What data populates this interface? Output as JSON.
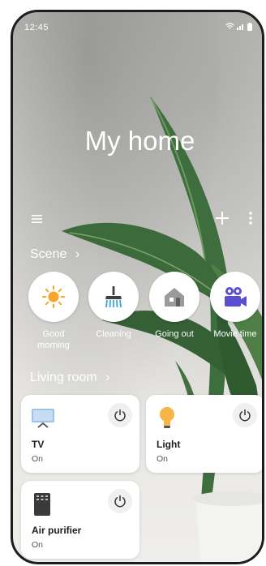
{
  "status_bar": {
    "time": "12:45",
    "icons": [
      "wifi-icon",
      "signal-icon",
      "battery-icon"
    ]
  },
  "header": {
    "title": "My home"
  },
  "toolbar": {
    "menu_icon": "menu-icon",
    "add_icon": "plus-icon",
    "more_icon": "more-vertical-icon"
  },
  "scene_section": {
    "label": "Scene",
    "items": [
      {
        "label": "Good morning",
        "icon": "sun-icon"
      },
      {
        "label": "Cleaning",
        "icon": "broom-icon"
      },
      {
        "label": "Going out",
        "icon": "house-icon"
      },
      {
        "label": "Movie time",
        "icon": "movie-camera-icon"
      }
    ]
  },
  "room_section": {
    "label": "Living room",
    "devices": [
      {
        "name": "TV",
        "status": "On",
        "icon": "tv-icon"
      },
      {
        "name": "Light",
        "status": "On",
        "icon": "bulb-icon"
      },
      {
        "name": "Air purifier",
        "status": "On",
        "icon": "air-purifier-icon"
      }
    ]
  },
  "colors": {
    "accent_sun": "#f6a62a",
    "accent_blue": "#4b8fd9",
    "movie_purple": "#5a4fcf",
    "card_bg": "#ffffff"
  }
}
